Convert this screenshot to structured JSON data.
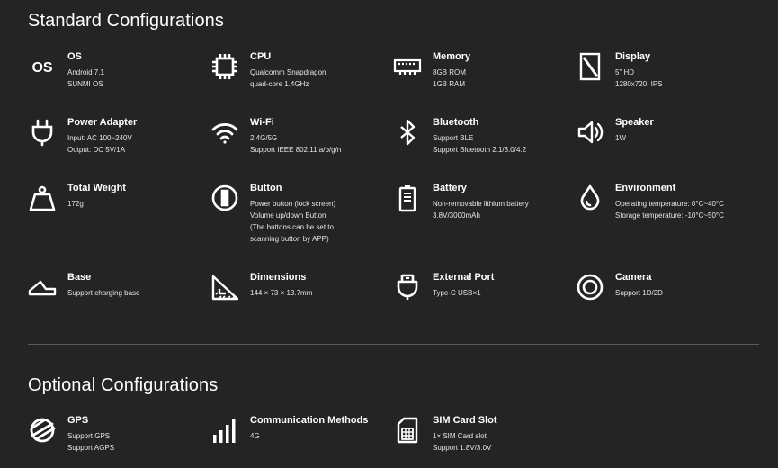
{
  "standard": {
    "title": "Standard Configurations",
    "items": [
      {
        "name": "OS",
        "icon": "os-icon",
        "values": [
          "Android 7.1",
          "SUNMI OS"
        ]
      },
      {
        "name": "CPU",
        "icon": "cpu-icon",
        "values": [
          "Qualcomm Snapdragon",
          "quad-core 1.4GHz"
        ]
      },
      {
        "name": "Memory",
        "icon": "memory-icon",
        "values": [
          "8GB ROM",
          "1GB RAM"
        ]
      },
      {
        "name": "Display",
        "icon": "display-icon",
        "values": [
          "5\" HD",
          "1280x720, IPS"
        ]
      },
      {
        "name": "Power Adapter",
        "icon": "plug-icon",
        "values": [
          "Input: AC 100~240V",
          "Output: DC 5V/1A"
        ]
      },
      {
        "name": "Wi-Fi",
        "icon": "wifi-icon",
        "values": [
          "2.4G/5G",
          "Support IEEE 802.11 a/b/g/n"
        ]
      },
      {
        "name": "Bluetooth",
        "icon": "bluetooth-icon",
        "values": [
          "Support BLE",
          "Support Bluetooth 2.1/3.0/4.2"
        ]
      },
      {
        "name": "Speaker",
        "icon": "speaker-icon",
        "values": [
          "1W"
        ]
      },
      {
        "name": "Total Weight",
        "icon": "weight-icon",
        "values": [
          "172g"
        ]
      },
      {
        "name": "Button",
        "icon": "button-icon",
        "values": [
          "Power button (lock screen)",
          "Volume up/down Button",
          "(The buttons can be set to",
          "scanning button by APP)"
        ]
      },
      {
        "name": "Battery",
        "icon": "battery-icon",
        "values": [
          "Non-removable lithium battery",
          "3.8V/3000mAh"
        ]
      },
      {
        "name": "Environment",
        "icon": "drop-icon",
        "values": [
          "Operating temperature: 0°C~40°C",
          "Storage temperature: -10°C~50°C"
        ]
      },
      {
        "name": "Base",
        "icon": "base-icon",
        "values": [
          "Support charging base"
        ]
      },
      {
        "name": "Dimensions",
        "icon": "dimensions-icon",
        "values": [
          "144 × 73 × 13.7mm"
        ]
      },
      {
        "name": "External Port",
        "icon": "usb-c-icon",
        "values": [
          "Type-C USB×1"
        ]
      },
      {
        "name": "Camera",
        "icon": "camera-icon",
        "values": [
          "Support 1D/2D"
        ]
      }
    ]
  },
  "optional": {
    "title": "Optional Configurations",
    "items": [
      {
        "name": "GPS",
        "icon": "gps-icon",
        "values": [
          "Support GPS",
          "Support AGPS"
        ]
      },
      {
        "name": "Communication Methods",
        "icon": "signal-icon",
        "values": [
          "4G"
        ]
      },
      {
        "name": "SIM Card Slot",
        "icon": "sim-icon",
        "values": [
          "1× SIM Card slot",
          "Support 1.8V/3.0V"
        ]
      }
    ]
  },
  "colors": {
    "background": "#242424",
    "text": "#ffffff",
    "divider": "#5a5a5a"
  }
}
